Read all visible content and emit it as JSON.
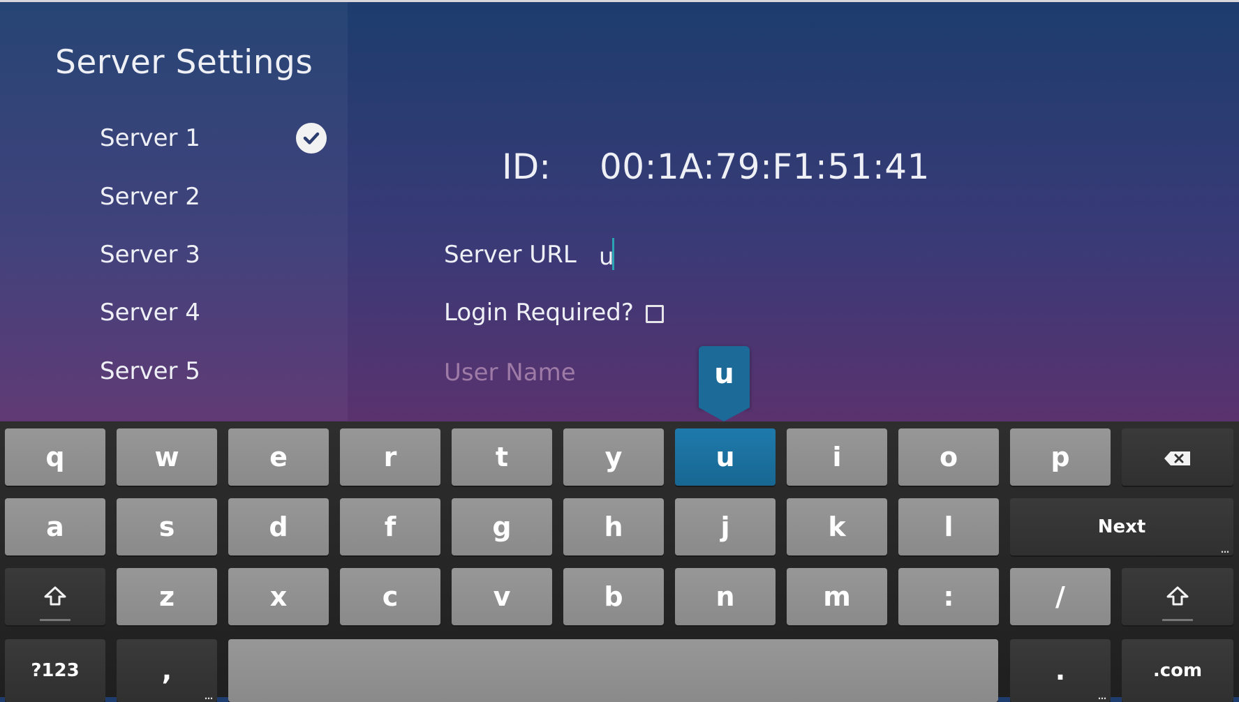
{
  "page": {
    "title": "Server Settings"
  },
  "sidebar": {
    "items": [
      {
        "label": "Server 1",
        "selected": true
      },
      {
        "label": "Server 2"
      },
      {
        "label": "Server 3"
      },
      {
        "label": "Server 4"
      },
      {
        "label": "Server 5"
      }
    ]
  },
  "details": {
    "id_label": "ID:",
    "id_value": "00:1A:79:F1:51:41",
    "server_url_label": "Server URL",
    "server_url_value": "u",
    "login_required_label": "Login Required?",
    "login_required_checked": false,
    "user_name_placeholder": "User Name"
  },
  "keyboard": {
    "preview_key": "u",
    "row1": [
      "q",
      "w",
      "e",
      "r",
      "t",
      "y",
      "u",
      "i",
      "o",
      "p"
    ],
    "row2": [
      "a",
      "s",
      "d",
      "f",
      "g",
      "h",
      "j",
      "k",
      "l"
    ],
    "row3": [
      "z",
      "x",
      "c",
      "v",
      "b",
      "n",
      "m",
      ":",
      "/"
    ],
    "next_label": "Next",
    "symbols_label": "?123",
    "comma_label": ",",
    "period_label": ".",
    "dotcom_label": ".com",
    "active_key": "u",
    "icons": {
      "backspace": "backspace-icon",
      "shift": "shift-icon",
      "check": "check-circle-icon"
    }
  },
  "colors": {
    "accent_key": "#1b6a97",
    "caret": "#2ca3b3"
  }
}
